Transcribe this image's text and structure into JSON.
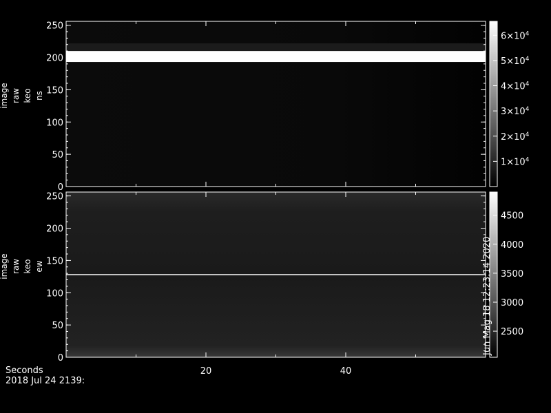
{
  "chart_data": [
    {
      "type": "heatmap",
      "ylabel_lines": [
        "image",
        "raw",
        "keo",
        "ns"
      ],
      "ylim": [
        0,
        256
      ],
      "yticks": [
        "0",
        "50",
        "100",
        "150",
        "200",
        "250"
      ],
      "xlim": [
        0,
        60
      ],
      "xticks": [
        "20",
        "40"
      ],
      "colorbar": {
        "ticks": [
          {
            "base": "1×10",
            "exp": "4"
          },
          {
            "base": "2×10",
            "exp": "4"
          },
          {
            "base": "3×10",
            "exp": "4"
          },
          {
            "base": "4×10",
            "exp": "4"
          },
          {
            "base": "5×10",
            "exp": "4"
          },
          {
            "base": "6×10",
            "exp": "4"
          }
        ],
        "range": [
          0,
          65535
        ]
      },
      "features": [
        {
          "kind": "bright_band",
          "y_range": [
            193,
            210
          ],
          "level": 1.0
        },
        {
          "kind": "dim_band",
          "y_range": [
            210,
            222
          ],
          "level": 0.1
        },
        {
          "kind": "background",
          "level": 0.03
        }
      ]
    },
    {
      "type": "heatmap",
      "ylabel_lines": [
        "image",
        "raw",
        "keo",
        "ew"
      ],
      "ylim": [
        0,
        256
      ],
      "yticks": [
        "0",
        "50",
        "100",
        "150",
        "200",
        "250"
      ],
      "xlim": [
        0,
        60
      ],
      "xticks": [
        "20",
        "40"
      ],
      "colorbar": {
        "ticks": [
          "2500",
          "3000",
          "3500",
          "4000",
          "4500"
        ],
        "range": [
          2050,
          4900
        ],
        "side_label": "Jun Mag 18 12:23:14 2020"
      },
      "features": [
        {
          "kind": "bright_line",
          "y": 128,
          "level": 0.75
        },
        {
          "kind": "background",
          "level": 0.1
        }
      ]
    }
  ],
  "footer": {
    "xlabel": "Seconds",
    "date": "2018 Jul 24 2139:"
  }
}
